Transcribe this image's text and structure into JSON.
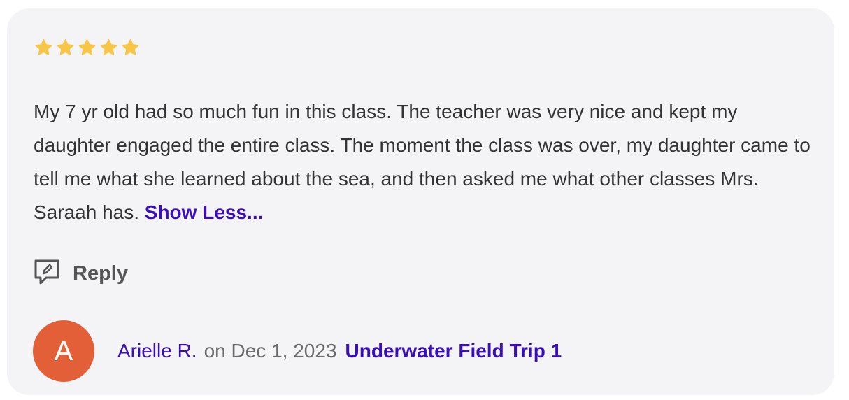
{
  "rating": {
    "stars": 5,
    "max": 5,
    "color": "#f7c548"
  },
  "review": {
    "text": "My 7 yr old had so much fun in this class. The teacher was very nice and kept my daughter engaged the entire class. The moment the class was over, my daughter came to tell me what she learned about the sea, and then asked me what other classes Mrs. Saraah has.",
    "toggle_label": "Show Less..."
  },
  "reply": {
    "label": "Reply",
    "icon": "reply-edit-icon"
  },
  "author": {
    "initial": "A",
    "name": "Arielle R.",
    "date_text": "on Dec 1, 2023",
    "avatar_color": "#e35f37"
  },
  "class_link": {
    "label": "Underwater Field Trip 1"
  },
  "colors": {
    "link": "#3b0fb8",
    "card_bg": "#f4f4f7"
  }
}
